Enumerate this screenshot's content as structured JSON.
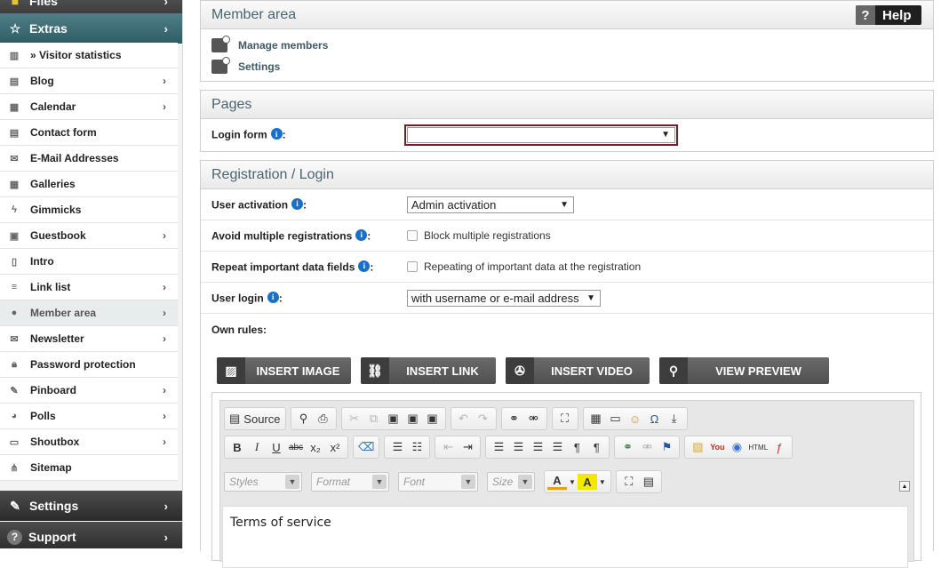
{
  "sidebar": {
    "top_section": {
      "label": "Files"
    },
    "extras_section": {
      "label": "Extras"
    },
    "items": [
      {
        "label": "» Visitor statistics",
        "icon": "bar-chart-icon",
        "arrow": false
      },
      {
        "label": "Blog",
        "icon": "blog-icon",
        "arrow": true
      },
      {
        "label": "Calendar",
        "icon": "calendar-icon",
        "arrow": true
      },
      {
        "label": "Contact form",
        "icon": "form-icon",
        "arrow": false
      },
      {
        "label": "E-Mail Addresses",
        "icon": "envelope-icon",
        "arrow": false
      },
      {
        "label": "Galleries",
        "icon": "grid-icon",
        "arrow": false
      },
      {
        "label": "Gimmicks",
        "icon": "bolt-icon",
        "arrow": false
      },
      {
        "label": "Guestbook",
        "icon": "book-icon",
        "arrow": true
      },
      {
        "label": "Intro",
        "icon": "page-icon",
        "arrow": false
      },
      {
        "label": "Link list",
        "icon": "list-icon",
        "arrow": true
      },
      {
        "label": "Member area",
        "icon": "user-icon",
        "arrow": true,
        "active": true
      },
      {
        "label": "Newsletter",
        "icon": "newsletter-icon",
        "arrow": true
      },
      {
        "label": "Password protection",
        "icon": "lock-icon",
        "arrow": false
      },
      {
        "label": "Pinboard",
        "icon": "pin-icon",
        "arrow": true
      },
      {
        "label": "Polls",
        "icon": "pie-icon",
        "arrow": true
      },
      {
        "label": "Shoutbox",
        "icon": "chat-icon",
        "arrow": true
      },
      {
        "label": "Sitemap",
        "icon": "sitemap-icon",
        "arrow": false
      }
    ],
    "settings_section": {
      "label": "Settings"
    },
    "support_section": {
      "label": "Support"
    }
  },
  "member_area": {
    "title": "Member area",
    "help_label": "Help",
    "links": [
      "Manage members",
      "Settings"
    ]
  },
  "pages": {
    "title": "Pages",
    "login_form_label": "Login form",
    "login_form_value": ""
  },
  "registration": {
    "title": "Registration / Login",
    "user_activation_label": "User activation",
    "user_activation_value": "Admin activation",
    "avoid_multiple_label": "Avoid multiple registrations",
    "avoid_multiple_text": "Block multiple registrations",
    "repeat_fields_label": "Repeat important data fields",
    "repeat_fields_text": "Repeating of important data at the registration",
    "user_login_label": "User login",
    "user_login_value": "with username or e-mail address",
    "own_rules_label": "Own rules:"
  },
  "insert_buttons": {
    "image": "INSERT IMAGE",
    "link": "INSERT LINK",
    "video": "INSERT VIDEO",
    "preview": "VIEW PREVIEW"
  },
  "editor": {
    "source_label": "Source",
    "styles_placeholder": "Styles",
    "format_placeholder": "Format",
    "font_placeholder": "Font",
    "size_placeholder": "Size",
    "content": "Terms of service"
  }
}
